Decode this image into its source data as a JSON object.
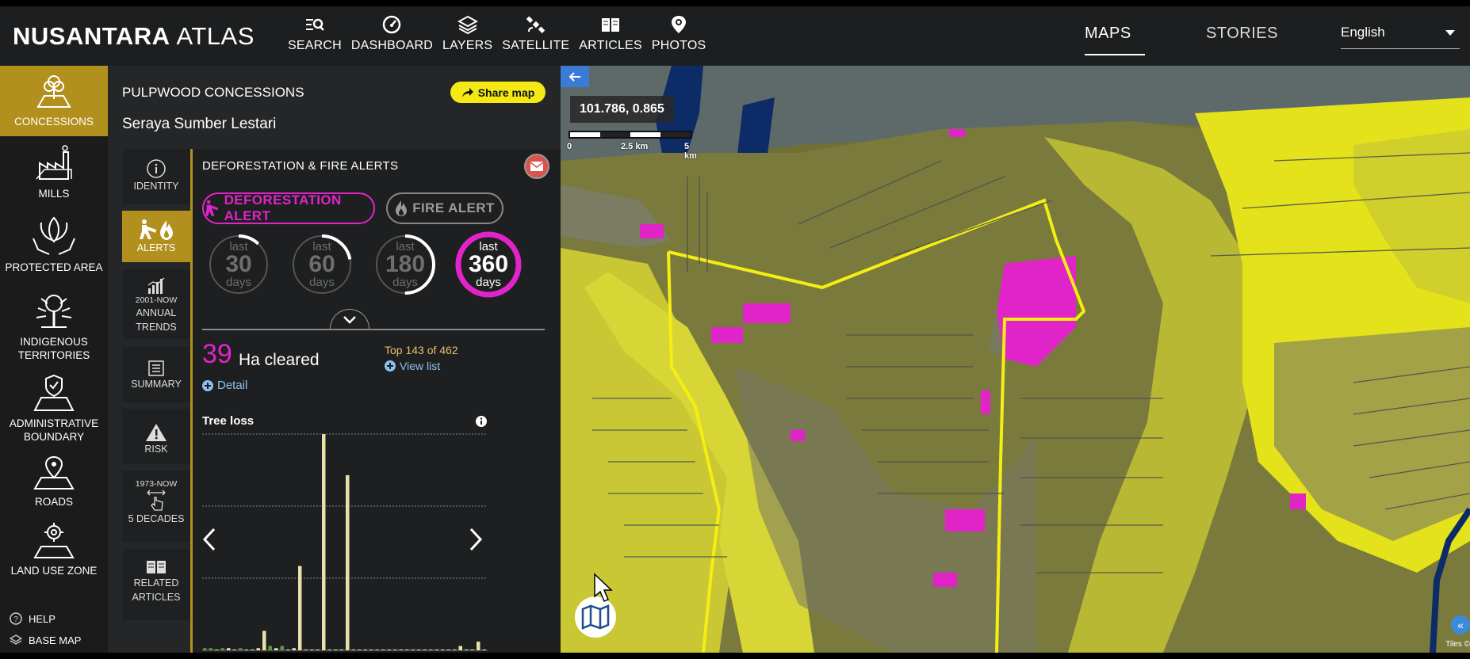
{
  "app": {
    "brand_bold": "NUSANTARA",
    "brand_thin": "ATLAS"
  },
  "topnav": [
    {
      "label": "SEARCH",
      "icon": "search-list-icon"
    },
    {
      "label": "DASHBOARD",
      "icon": "gauge-icon"
    },
    {
      "label": "LAYERS",
      "icon": "layers-icon"
    },
    {
      "label": "SATELLITE",
      "icon": "satellite-icon"
    },
    {
      "label": "ARTICLES",
      "icon": "book-icon"
    },
    {
      "label": "PHOTOS",
      "icon": "camera-pin-icon"
    }
  ],
  "topright": {
    "maps": "MAPS",
    "stories": "STORIES",
    "language": "English"
  },
  "leftnav": [
    {
      "label": "CONCESSIONS",
      "active": true
    },
    {
      "label": "MILLS"
    },
    {
      "label": "PROTECTED AREA"
    },
    {
      "label": "INDIGENOUS\nTERRITORIES"
    },
    {
      "label": "ADMINISTRATIVE\nBOUNDARY"
    },
    {
      "label": "ROADS"
    },
    {
      "label": "LAND USE ZONE"
    }
  ],
  "leftnav_bottom": {
    "help": "HELP",
    "basemap": "BASE MAP"
  },
  "panel": {
    "title": "PULPWOOD CONCESSIONS",
    "subtitle": "Seraya Sumber Lestari",
    "share_label": "Share map"
  },
  "subnav": [
    {
      "label": "IDENTITY"
    },
    {
      "label": "ALERTS",
      "active": true
    },
    {
      "top": "2001-NOW",
      "label": "ANNUAL\nTRENDS"
    },
    {
      "label": "SUMMARY"
    },
    {
      "label": "RISK"
    },
    {
      "top": "1973-NOW",
      "label": "5 DECADES"
    },
    {
      "label": "RELATED\nARTICLES"
    }
  ],
  "alerts": {
    "title": "DEFORESTATION & FIRE ALERTS",
    "tab_deforestation": "DEFORESTATION ALERT",
    "tab_fire": "FIRE ALERT",
    "periods": [
      {
        "top": "last",
        "value": "30",
        "unit": "days",
        "fraction": 0.12
      },
      {
        "top": "last",
        "value": "60",
        "unit": "days",
        "fraction": 0.22
      },
      {
        "top": "last",
        "value": "180",
        "unit": "days",
        "fraction": 0.5
      },
      {
        "top": "last",
        "value": "360",
        "unit": "days",
        "fraction": 1.0,
        "selected": true
      }
    ],
    "cleared_value": "39",
    "cleared_unit": "Ha cleared",
    "detail_label": "Detail",
    "rank_text": "Top 143 of 462",
    "view_list_label": "View list",
    "tree_loss_label": "Tree loss"
  },
  "chart_data": {
    "type": "bar",
    "title": "Tree loss",
    "values_relative": [
      0.01,
      0.01,
      0.0,
      0.01,
      0.01,
      0.0,
      0.01,
      0.0,
      0.0,
      0.01,
      0.09,
      0.02,
      0.01,
      0.02,
      0.0,
      0.01,
      0.39,
      0.0,
      0.0,
      0.0,
      1.0,
      0.0,
      0.0,
      0.0,
      0.81,
      0.0,
      0.0,
      0.0,
      0.0,
      0.0,
      0.0,
      0.0,
      0.0,
      0.0,
      0.0,
      0.0,
      0.0,
      0.0,
      0.0,
      0.0,
      0.0,
      0.0,
      0.0,
      0.02,
      0.0,
      0.0,
      0.04,
      0.0
    ],
    "highlight_indices": [
      0,
      1,
      3,
      6,
      11,
      13
    ],
    "colors": {
      "bar": "#e9e0a8",
      "highlight": "#5a9a3a"
    },
    "grid": true
  },
  "map": {
    "coordinate": "101.786, 0.865",
    "scale_labels": [
      "0",
      "2.5 km",
      "5 km"
    ],
    "attribution": "Tiles ©"
  },
  "colors": {
    "accent": "#b2901e",
    "magenta": "#e024c8",
    "share": "#f4e915",
    "link": "#8fc1ee"
  }
}
